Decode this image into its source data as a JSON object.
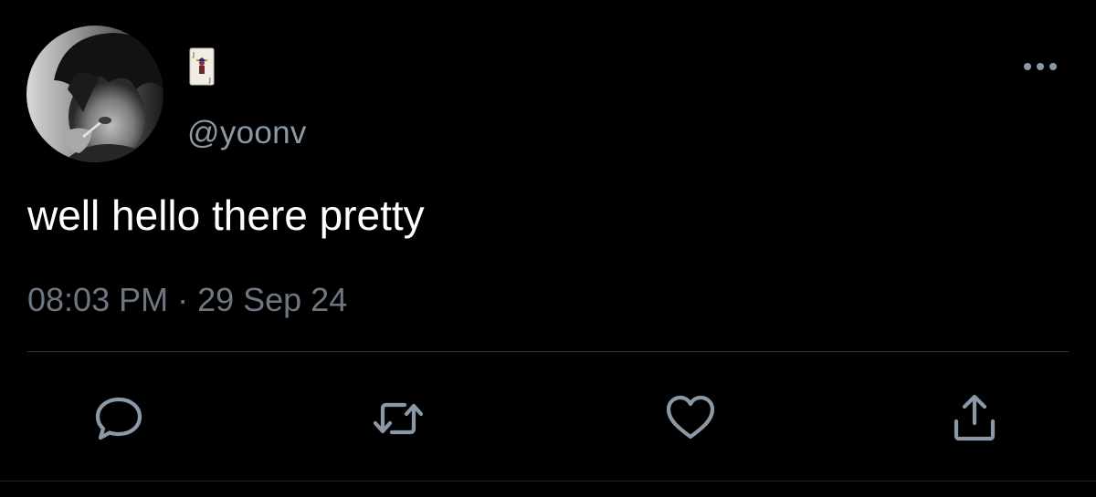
{
  "tweet": {
    "display_name_icon": "joker-playing-card-icon",
    "handle": "@yoonv",
    "text": "well hello there pretty",
    "timestamp": "08:03 PM · 29 Sep 24"
  },
  "actions": {
    "reply_icon": "reply-icon",
    "retweet_icon": "retweet-icon",
    "like_icon": "heart-icon",
    "share_icon": "share-icon",
    "more_icon": "more-options-icon"
  },
  "colors": {
    "background": "#000000",
    "text": "#ffffff",
    "secondary_text": "#8b98a5",
    "icon": "#8b98a5",
    "divider": "#2f3336"
  }
}
